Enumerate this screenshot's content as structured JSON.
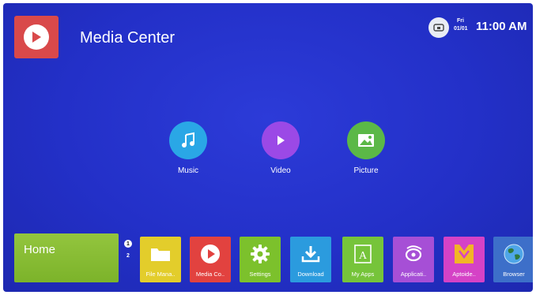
{
  "header": {
    "title": "Media Center",
    "app_icon": "play-icon",
    "status": {
      "day": "Fri",
      "date": "01/01",
      "time": "11:00 AM",
      "network_icon": "ethernet-icon"
    }
  },
  "media": [
    {
      "label": "Music",
      "icon": "music-note-icon",
      "color": "#2aa7e6"
    },
    {
      "label": "Video",
      "icon": "play-icon",
      "color": "#9b49e6"
    },
    {
      "label": "Picture",
      "icon": "picture-icon",
      "color": "#5bb847"
    }
  ],
  "dock": {
    "home_label": "Home",
    "badges": [
      "1",
      "2"
    ],
    "tiles": [
      {
        "label": "File Mana..",
        "icon": "folder-icon",
        "color": "#e3cd2b"
      },
      {
        "label": "Media Co..",
        "icon": "play-icon",
        "color": "#e2423f"
      },
      {
        "label": "Settings",
        "icon": "gear-icon",
        "color": "#7cc12c"
      },
      {
        "label": "Download",
        "icon": "download-icon",
        "color": "#2b9bde"
      },
      {
        "label": "My Apps",
        "icon": "apps-icon",
        "color": "#76c43a"
      },
      {
        "label": "Applicati..",
        "icon": "app-store-icon",
        "color": "#a64fd6"
      },
      {
        "label": "Aptoide..",
        "icon": "aptoide-icon",
        "color": "#d542c6"
      },
      {
        "label": "Browser",
        "icon": "globe-icon",
        "color": "#3d6fc9"
      }
    ]
  }
}
